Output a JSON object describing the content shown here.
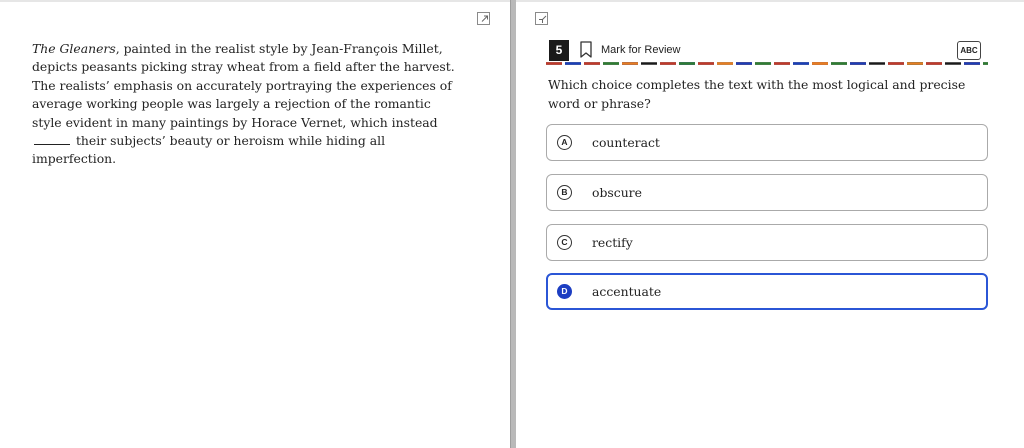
{
  "passage": {
    "title_italic": "The Gleaners",
    "before_blank": ", painted in the realist style by Jean-François Millet, depicts peasants picking stray wheat from a field after the harvest. The realists’ emphasis on accurately portraying the experiences of average working people was largely a rejection of the romantic style evident in many paintings by Horace Vernet, which instead",
    "after_blank": "their subjects’ beauty or heroism while hiding all imperfection."
  },
  "question_header": {
    "number": "5",
    "mark_label": "Mark for Review",
    "abc_label": "ABC",
    "icons": [
      "bookmark-icon",
      "strikethrough-abc-icon",
      "expand-icon"
    ]
  },
  "question": {
    "prompt": "Which choice completes the text with the most logical and precise word or phrase?"
  },
  "choices": [
    {
      "letter": "A",
      "text": "counteract",
      "selected": false
    },
    {
      "letter": "B",
      "text": "obscure",
      "selected": false
    },
    {
      "letter": "C",
      "text": "rectify",
      "selected": false
    },
    {
      "letter": "D",
      "text": "accentuate",
      "selected": true
    }
  ],
  "colors": {
    "accent": "#2b56d6",
    "selected_letter_bg": "#1d3ec2",
    "divider": "#b9b9b9",
    "dash_palette": [
      "#c0392b",
      "#2e7d32",
      "#1a3fb8",
      "#e67e22",
      "#4caf50",
      "#1a1a1a"
    ]
  }
}
